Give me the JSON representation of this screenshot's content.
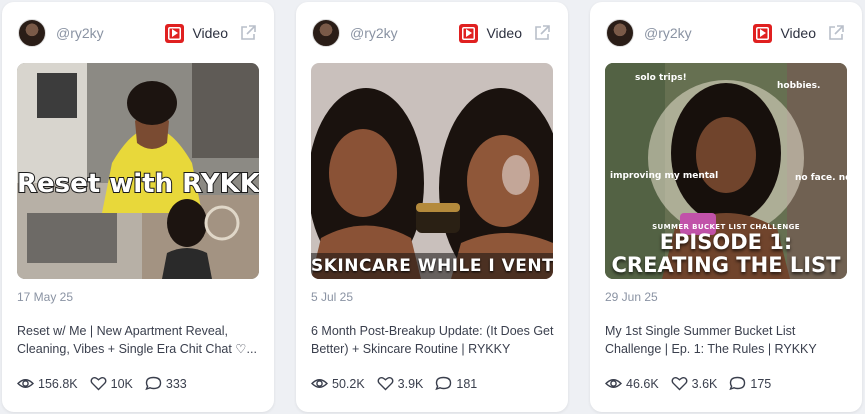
{
  "cards": [
    {
      "handle": "@ry2ky",
      "platform": "Video",
      "thumbnail_text": "Reset with RYKKY",
      "date": "17 May 25",
      "title": "Reset w/ Me | New Apartment Reveal, Cleaning, Vibes + Single Era Chit Chat ♡...",
      "views": "156.8K",
      "likes": "10K",
      "comments": "333"
    },
    {
      "handle": "@ry2ky",
      "platform": "Video",
      "thumbnail_text": "SKINCARE WHILE I VENT",
      "date": "5 Jul 25",
      "title": "6 Month Post-Breakup Update: (It Does Get Better) + Skincare Routine | RYKKY",
      "views": "50.2K",
      "likes": "3.9K",
      "comments": "181"
    },
    {
      "handle": "@ry2ky",
      "platform": "Video",
      "thumbnail_small_text": "SUMMER BUCKET LIST CHALLENGE",
      "thumbnail_line1": "EPISODE 1:",
      "thumbnail_line2": "CREATING THE LIST",
      "thumbnail_notes": [
        "solo trips!",
        "hobbies.",
        "improving my mental",
        "no face. no case."
      ],
      "date": "29 Jun 25",
      "title": "My 1st Single Summer Bucket List Challenge | Ep. 1: The Rules | RYKKY",
      "views": "46.6K",
      "likes": "3.6K",
      "comments": "175"
    }
  ],
  "icons": {
    "platform": "youtube-icon",
    "external": "external-link-icon",
    "views": "eye-icon",
    "likes": "heart-icon",
    "comments": "comment-icon"
  },
  "colors": {
    "youtube_red": "#e02020",
    "muted_text": "#8a93a3",
    "body_text": "#3a3f4d",
    "page_background": "#eef0f4"
  }
}
